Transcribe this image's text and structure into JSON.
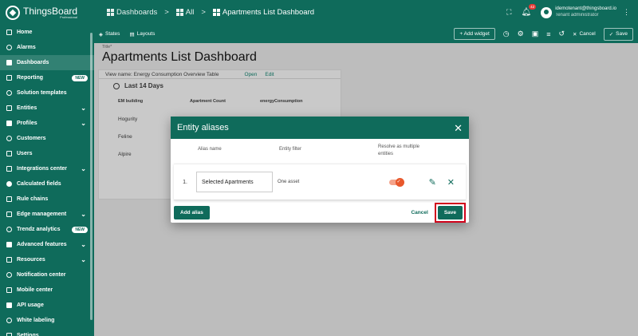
{
  "app": {
    "name": "ThingsBoard",
    "edition": "Professional"
  },
  "breadcrumb": {
    "dashboards": "Dashboards",
    "all": "All",
    "current": "Apartments List Dashboard",
    "separator": ">"
  },
  "header": {
    "notifications_count": "42",
    "user_email": "idemotenant@thingsboard.io",
    "user_role": "Tenant administrator"
  },
  "sidebar": {
    "items": [
      {
        "label": "Home",
        "icon": "home-icon"
      },
      {
        "label": "Alarms",
        "icon": "alarm-icon"
      },
      {
        "label": "Dashboards",
        "icon": "dashboards-icon",
        "active": true
      },
      {
        "label": "Reporting",
        "icon": "reporting-icon",
        "badge": "NEW"
      },
      {
        "label": "Solution templates",
        "icon": "templates-icon"
      },
      {
        "label": "Entities",
        "icon": "entities-icon",
        "expand": true
      },
      {
        "label": "Profiles",
        "icon": "profiles-icon",
        "expand": true
      },
      {
        "label": "Customers",
        "icon": "customers-icon"
      },
      {
        "label": "Users",
        "icon": "users-icon"
      },
      {
        "label": "Integrations center",
        "icon": "integrations-icon",
        "expand": true
      },
      {
        "label": "Calculated fields",
        "icon": "calculated-fields-icon"
      },
      {
        "label": "Rule chains",
        "icon": "rule-chains-icon"
      },
      {
        "label": "Edge management",
        "icon": "edge-icon",
        "expand": true
      },
      {
        "label": "Trendz analytics",
        "icon": "trendz-icon",
        "badge": "NEW"
      },
      {
        "label": "Advanced features",
        "icon": "advanced-icon",
        "expand": true
      },
      {
        "label": "Resources",
        "icon": "resources-icon",
        "expand": true
      },
      {
        "label": "Notification center",
        "icon": "notification-icon"
      },
      {
        "label": "Mobile center",
        "icon": "mobile-icon"
      },
      {
        "label": "API usage",
        "icon": "api-icon"
      },
      {
        "label": "White labeling",
        "icon": "white-labeling-icon"
      },
      {
        "label": "Settings",
        "icon": "settings-icon"
      }
    ]
  },
  "toolbar": {
    "states": "States",
    "layouts": "Layouts",
    "add_widget": "+ Add widget",
    "cancel": "Cancel",
    "save": "Save"
  },
  "page": {
    "title_label": "Title*",
    "title": "Apartments List Dashboard"
  },
  "widget": {
    "view_name": "View name: Energy Consumption Overview Table",
    "open": "Open",
    "edit": "Edit",
    "period": "Last 14 Days",
    "columns": [
      "EM building",
      "Apartment Count",
      "energyConsumption"
    ],
    "rows": [
      "Hogurity",
      "Feline",
      "Alpire"
    ]
  },
  "dialog": {
    "title": "Entity aliases",
    "col_alias": "Alias name",
    "col_filter": "Entity filter",
    "col_resolve": "Resolve as multiple entities",
    "row_number": "1.",
    "alias_name": "Selected Apartments",
    "filter": "One asset",
    "resolve_multiple": true,
    "add_alias": "Add alias",
    "cancel": "Cancel",
    "save": "Save"
  },
  "colors": {
    "primary": "#0f6b5b",
    "toggle": "#e8582c",
    "highlight": "#d0021b"
  }
}
